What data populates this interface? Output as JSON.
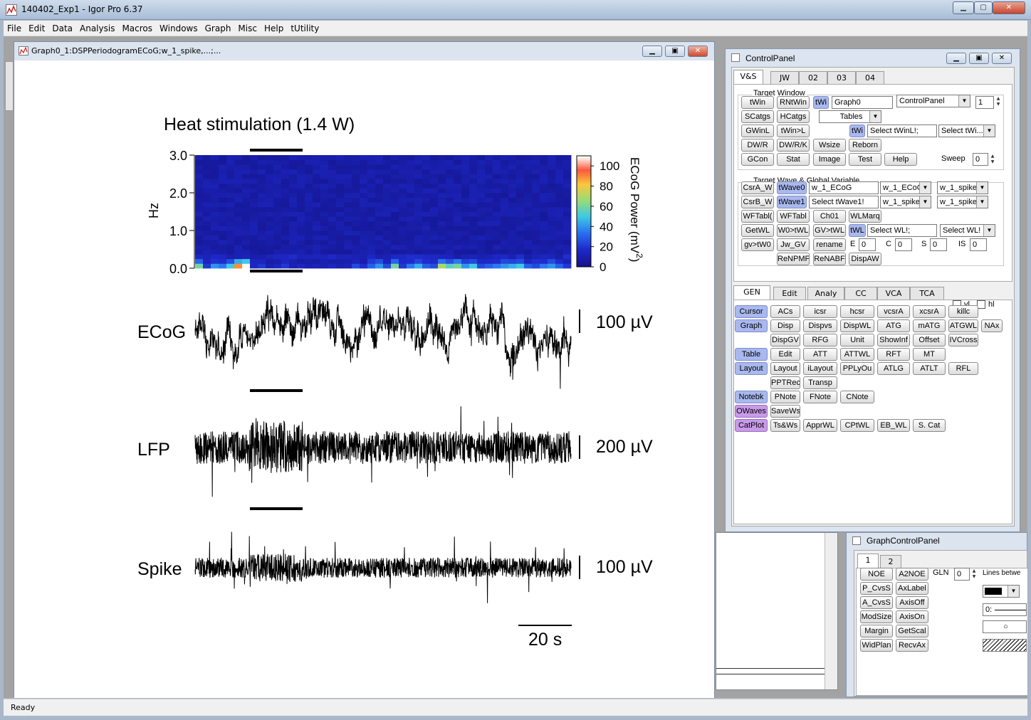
{
  "app": {
    "title": "140402_Exp1 - Igor Pro 6.37",
    "status": "Ready"
  },
  "menu": [
    "File",
    "Edit",
    "Data",
    "Analysis",
    "Macros",
    "Windows",
    "Graph",
    "Misc",
    "Help",
    "tUtility"
  ],
  "graph": {
    "title": "Graph0_1:DSPPeriodogramECoG;w_1_spike,...;...",
    "heading": "Heat stimulation (1.4 W)",
    "y_ticks": [
      "3.0",
      "2.0",
      "1.0",
      "0.0"
    ],
    "y_label": "Hz",
    "colorbar_ticks": [
      "100",
      "80",
      "60",
      "40",
      "20",
      "0"
    ],
    "colorbar_label": "ECoG Power (mV",
    "colorbar_label_sup": "2",
    "colorbar_label_close": ")",
    "traces": [
      {
        "name": "ECoG",
        "scale": "100 µV"
      },
      {
        "name": "LFP",
        "scale": "200 µV"
      },
      {
        "name": "Spike",
        "scale": "100 µV"
      }
    ],
    "time_scale": "20 s"
  },
  "chart_data": {
    "type": "heatmap",
    "title": "Heat stimulation (1.4 W)",
    "ylabel": "Hz",
    "ylim": [
      0.0,
      3.0
    ],
    "colorbar": {
      "label": "ECoG Power (mV^2)",
      "range": [
        0,
        110
      ]
    },
    "low_freq_row_power": [
      60,
      20,
      40,
      35,
      50,
      90,
      110,
      15,
      20,
      10,
      15,
      20,
      10,
      15,
      10,
      12,
      10,
      15,
      10,
      12,
      25,
      18,
      30,
      40,
      25,
      60,
      20,
      35,
      45,
      30,
      25,
      70,
      55,
      60,
      40,
      50,
      25,
      30,
      35,
      40,
      45,
      50,
      30,
      25,
      35,
      40,
      30,
      20
    ]
  },
  "controlpanel": {
    "title": "ControlPanel",
    "tabs": [
      "V&S",
      "JW",
      "02",
      "03",
      "04"
    ],
    "target_window": "Target Window",
    "target_wave": "Target Wave & Global Variable",
    "r1": {
      "b1": "tWin",
      "b2": "RNtWin",
      "b3": "tWi",
      "input": "Graph0",
      "dd": "ControlPanel",
      "num": "1"
    },
    "r2": {
      "b1": "SCatgs",
      "b2": "HCatgs",
      "dd": "Tables"
    },
    "r3": {
      "b1": "GWinL",
      "b2": "tWin>L",
      "b3": "tWi",
      "input": "Select tWinL!;",
      "dd": "Select tWi..."
    },
    "r4": {
      "b1": "DW/R",
      "b2": "DW/R/K",
      "b3": "Wsize",
      "b4": "Reborn"
    },
    "r5": {
      "b1": "GCon",
      "b2": "Stat",
      "b3": "Image",
      "b4": "Test",
      "b5": "Help",
      "sweep_label": "Sweep",
      "sweep": "0"
    },
    "w1": {
      "b1": "CsrA_W",
      "b2": "tWave0",
      "input": "w_1_ECoG",
      "dd1": "w_1_ECoG",
      "dd2": "w_1_spike"
    },
    "w2": {
      "b1": "CsrB_W",
      "b2": "tWave1",
      "input": "Select tWave1!",
      "dd1": "w_1_spike",
      "dd2": "w_1_spike"
    },
    "w3": {
      "b1": "WFTabl(",
      "b2": "WFTabl",
      "b3": "Ch01",
      "b4": "WLMarq"
    },
    "w4": {
      "b1": "GetWL",
      "b2": "W0>tWL",
      "b3": "GV>tWL",
      "b4": "tWL",
      "input": "Select WL!;",
      "dd": "Select WL!"
    },
    "w5": {
      "b1": "gv>tW0",
      "b2": "Jw_GV",
      "b3": "rename",
      "e": "E",
      "ev": "0",
      "c": "C",
      "cv": "0",
      "s": "S",
      "sv": "0",
      "is": "IS",
      "isv": "0"
    },
    "w6": {
      "b1": "ReNPMF",
      "b2": "ReNABF",
      "b3": "DispAW"
    },
    "tabs2": [
      "GEN",
      "Edit",
      "Analy",
      "CC",
      "VCA",
      "TCA"
    ],
    "vl": "vl",
    "hl": "hl",
    "g1": [
      "Cursor",
      "ACs",
      "icsr",
      "hcsr",
      "vcsrA",
      "xcsrA",
      "killc"
    ],
    "g2": [
      "Graph",
      "Disp",
      "Dispvs",
      "DispWL",
      "ATG",
      "mATG",
      "ATGWL",
      "NAx"
    ],
    "g3": [
      "DispGV",
      "RFG",
      "Unit",
      "ShowInf",
      "Offset",
      "IVCross"
    ],
    "g4": [
      "Table",
      "Edit",
      "ATT",
      "ATTWL",
      "RFT",
      "MT"
    ],
    "g5": [
      "Layout",
      "Layout",
      "iLayout",
      "PPLyOu",
      "ATLG",
      "ATLT",
      "RFL"
    ],
    "g6": [
      "PPTRec",
      "Transp"
    ],
    "g7": [
      "Notebk",
      "PNote",
      "FNote",
      "CNote"
    ],
    "g8": [
      "OWaves",
      "SaveWs"
    ],
    "g9": [
      "CatPlot",
      "Ts&Ws",
      "ApprWL",
      "CPtWL",
      "EB_WL",
      "S. Cat"
    ]
  },
  "graphcontrol": {
    "title": "GraphControlPanel",
    "tabs": [
      "1",
      "2"
    ],
    "b": [
      "NOE",
      "A2NOE",
      "P_CvsS",
      "AxLabel",
      "A_CvsS",
      "AxisOff",
      "ModSize",
      "AxisOn",
      "Margin",
      "GetScal",
      "WidPlan",
      "RecvAx"
    ],
    "gln": "GLN",
    "gln_val": "0",
    "lines": "Lines betwe",
    "linestyle": "0:"
  }
}
